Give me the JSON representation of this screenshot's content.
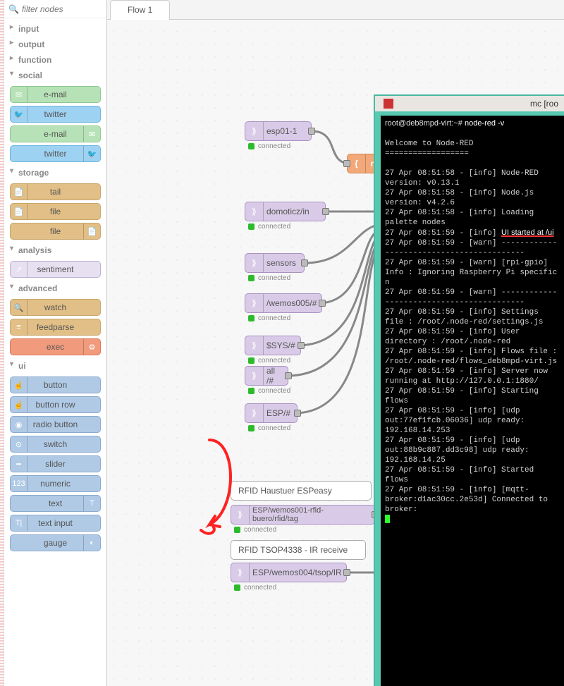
{
  "search": {
    "placeholder": "filter nodes"
  },
  "palette": {
    "cats": [
      {
        "name": "input",
        "open": false,
        "items": []
      },
      {
        "name": "output",
        "open": false,
        "items": []
      },
      {
        "name": "function",
        "open": false,
        "items": []
      },
      {
        "name": "social",
        "open": true,
        "items": [
          {
            "label": "e-mail",
            "cls": "c-green",
            "side": "left",
            "icon": "mail"
          },
          {
            "label": "twitter",
            "cls": "c-blue",
            "side": "left",
            "icon": "bird"
          },
          {
            "label": "e-mail",
            "cls": "c-green",
            "side": "right",
            "icon": "mail"
          },
          {
            "label": "twitter",
            "cls": "c-blue",
            "side": "right",
            "icon": "bird"
          }
        ]
      },
      {
        "name": "storage",
        "open": true,
        "items": [
          {
            "label": "tail",
            "cls": "c-tan",
            "side": "left",
            "icon": "file"
          },
          {
            "label": "file",
            "cls": "c-tan",
            "side": "left",
            "icon": "file"
          },
          {
            "label": "file",
            "cls": "c-tan",
            "side": "right",
            "icon": "file"
          }
        ]
      },
      {
        "name": "analysis",
        "open": true,
        "items": [
          {
            "label": "sentiment",
            "cls": "c-lil",
            "side": "left",
            "icon": "arrow"
          }
        ]
      },
      {
        "name": "advanced",
        "open": true,
        "items": [
          {
            "label": "watch",
            "cls": "c-tan",
            "side": "left",
            "icon": "search"
          },
          {
            "label": "feedparse",
            "cls": "c-tan",
            "side": "left",
            "icon": "rss"
          },
          {
            "label": "exec",
            "cls": "c-tom",
            "side": "right",
            "icon": "cog"
          }
        ]
      },
      {
        "name": "ui",
        "open": true,
        "items": [
          {
            "label": "button",
            "cls": "c-steel",
            "side": "left",
            "icon": "hand"
          },
          {
            "label": "button row",
            "cls": "c-steel",
            "side": "left",
            "icon": "hand"
          },
          {
            "label": "radio button",
            "cls": "c-steel",
            "side": "left",
            "icon": "dot"
          },
          {
            "label": "switch",
            "cls": "c-steel",
            "side": "left",
            "icon": "toggle"
          },
          {
            "label": "slider",
            "cls": "c-steel",
            "side": "left",
            "icon": "slider"
          },
          {
            "label": "numeric",
            "cls": "c-steel",
            "side": "left",
            "icon": "123"
          },
          {
            "label": "text",
            "cls": "c-steel",
            "side": "right",
            "icon": "T"
          },
          {
            "label": "text input",
            "cls": "c-steel",
            "side": "left",
            "icon": "Ti"
          },
          {
            "label": "gauge",
            "cls": "c-steel",
            "side": "right",
            "icon": "gauge"
          }
        ]
      }
    ]
  },
  "tabs": [
    {
      "label": "Flow 1"
    }
  ],
  "nodes": {
    "esp01": {
      "label": "esp01-1",
      "status": "connected"
    },
    "ret": {
      "label": "return"
    },
    "domo": {
      "label": "domoticz/in",
      "status": "connected"
    },
    "sensors": {
      "label": "sensors",
      "status": "connected"
    },
    "wemos": {
      "label": "/wemos005/#",
      "status": "connected"
    },
    "sys": {
      "label": "$SYS/#",
      "status": "connected"
    },
    "all": {
      "label": "all /#",
      "status": "connected"
    },
    "espf": {
      "label": "ESP/#",
      "status": "connected"
    },
    "rfidc": {
      "label": "RFID Haustuer ESPeasy"
    },
    "rfid": {
      "label": "ESP/wemos001-rfid-buero/rfid/tag",
      "status": "connected"
    },
    "tsopc": {
      "label": "RFID TSOP4338 - IR receive"
    },
    "tsop": {
      "label": "ESP/wemos004/tsop/IR",
      "status": "connected"
    }
  },
  "terminal": {
    "title": "mc [roo",
    "prompt": "root@deb8mpd-virt:~# ",
    "cmd": "node-red -v",
    "welcome": "Welcome to Node-RED",
    "lines": [
      "27 Apr 08:51:58 - [info] Node-RED version: v0.13.1",
      "27 Apr 08:51:58 - [info] Node.js  version: v4.2.6",
      "27 Apr 08:51:58 - [info] Loading palette nodes",
      "27 Apr 08:51:59 - [info] UI started at /ui",
      "27 Apr 08:51:59 - [warn] ------------------------------------------",
      "27 Apr 08:51:59 - [warn] [rpi-gpio] Info : Ignoring Raspberry Pi specific n",
      "27 Apr 08:51:59 - [warn] ------------------------------------------",
      "27 Apr 08:51:59 - [info] Settings file  : /root/.node-red/settings.js",
      "27 Apr 08:51:59 - [info] User directory : /root/.node-red",
      "27 Apr 08:51:59 - [info] Flows file : /root/.node-red/flows_deb8mpd-virt.js",
      "27 Apr 08:51:59 - [info] Server now running at http://127.0.0.1:1880/",
      "27 Apr 08:51:59 - [info] Starting flows",
      "27 Apr 08:51:59 - [info] [udp out:77ef1fcb.06036] udp ready: 192.168.14.253",
      "27 Apr 08:51:59 - [info] [udp out:88b9c887.dd3c98] udp ready: 192.168.14.25",
      "27 Apr 08:51:59 - [info] Started flows",
      "27 Apr 08:51:59 - [info] [mqtt-broker:d1ac30cc.2e53d] Connected to broker: "
    ]
  }
}
